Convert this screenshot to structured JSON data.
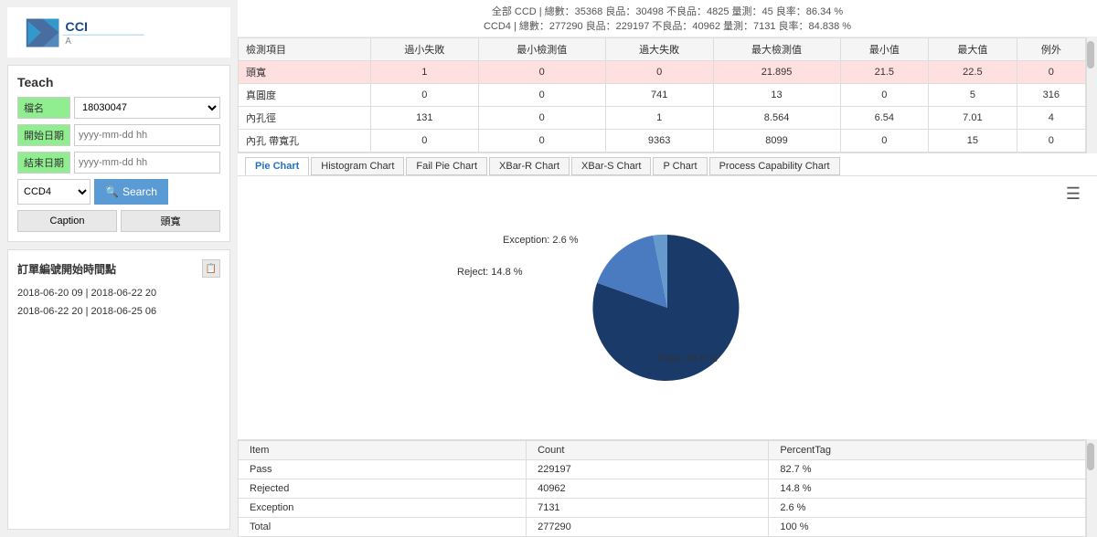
{
  "logo": {
    "alt": "CCIA Logo"
  },
  "left": {
    "teach_title": "Teach",
    "file_label": "檔名",
    "file_value": "18030047",
    "start_date_label": "開始日期",
    "start_date_placeholder": "yyyy-mm-dd hh",
    "end_date_label": "結束日期",
    "end_date_placeholder": "yyyy-mm-dd hh",
    "ccd_option": "CCD4",
    "search_btn": "Search",
    "caption_btn": "Caption",
    "chan_btn": "頭寬",
    "order_title": "訂單編號開始時間點",
    "date1_start": "2018-06-20 09",
    "date1_sep": "|",
    "date1_end": "2018-06-22 20",
    "date2_start": "2018-06-22 20",
    "date2_sep": "|",
    "date2_end": "2018-06-25 06"
  },
  "stats": {
    "line1": "全部 CCD | 總數：35368 良品：30498 不良品：4825 量測：45 良率：86.34 %",
    "line2": "CCD4 | 總數：277290 良品：229197 不良品：40962 量測：7131 良率：84.838 %"
  },
  "table": {
    "headers": [
      "檢測項目",
      "過小失敗",
      "最小檢測值",
      "過大失敗",
      "最大檢測值",
      "最小值",
      "最大值",
      "例外"
    ],
    "rows": [
      {
        "name": "頭寬",
        "v1": "1",
        "v2": "0",
        "v3": "0",
        "v4": "21.895",
        "v5": "21.5",
        "v6": "22.5",
        "v7": "0",
        "highlight": true
      },
      {
        "name": "真圓度",
        "v1": "0",
        "v2": "0",
        "v3": "741",
        "v4": "13",
        "v5": "0",
        "v6": "5",
        "v7": "316",
        "highlight": false
      },
      {
        "name": "內孔徑",
        "v1": "131",
        "v2": "0",
        "v3": "1",
        "v4": "8.564",
        "v5": "6.54",
        "v6": "7.01",
        "v7": "4",
        "highlight": false
      },
      {
        "name": "內孔 帶寬孔",
        "v1": "0",
        "v2": "0",
        "v3": "9363",
        "v4": "8099",
        "v5": "0",
        "v6": "15",
        "v7": "0",
        "highlight": false
      }
    ]
  },
  "chart_tabs": [
    {
      "label": "Pie Chart",
      "active": true
    },
    {
      "label": "Histogram Chart",
      "active": false
    },
    {
      "label": "Fail Pie Chart",
      "active": false
    },
    {
      "label": "XBar-R Chart",
      "active": false
    },
    {
      "label": "XBar-S Chart",
      "active": false
    },
    {
      "label": "P Chart",
      "active": false
    },
    {
      "label": "Process Capability Chart",
      "active": false
    }
  ],
  "pie": {
    "pass_label": "Pass: 82.6 %",
    "reject_label": "Reject: 14.8 %",
    "exception_label": "Exception: 2.6 %",
    "pass_pct": 82.6,
    "reject_pct": 14.8,
    "exception_pct": 2.6
  },
  "result_table": {
    "headers": [
      "Item",
      "Count",
      "PercentTag"
    ],
    "rows": [
      {
        "item": "Pass",
        "count": "229197",
        "pct": "82.7 %"
      },
      {
        "item": "Rejected",
        "count": "40962",
        "pct": "14.8 %"
      },
      {
        "item": "Exception",
        "count": "7131",
        "pct": "2.6 %"
      },
      {
        "item": "Total",
        "count": "277290",
        "pct": "100 %"
      }
    ]
  }
}
